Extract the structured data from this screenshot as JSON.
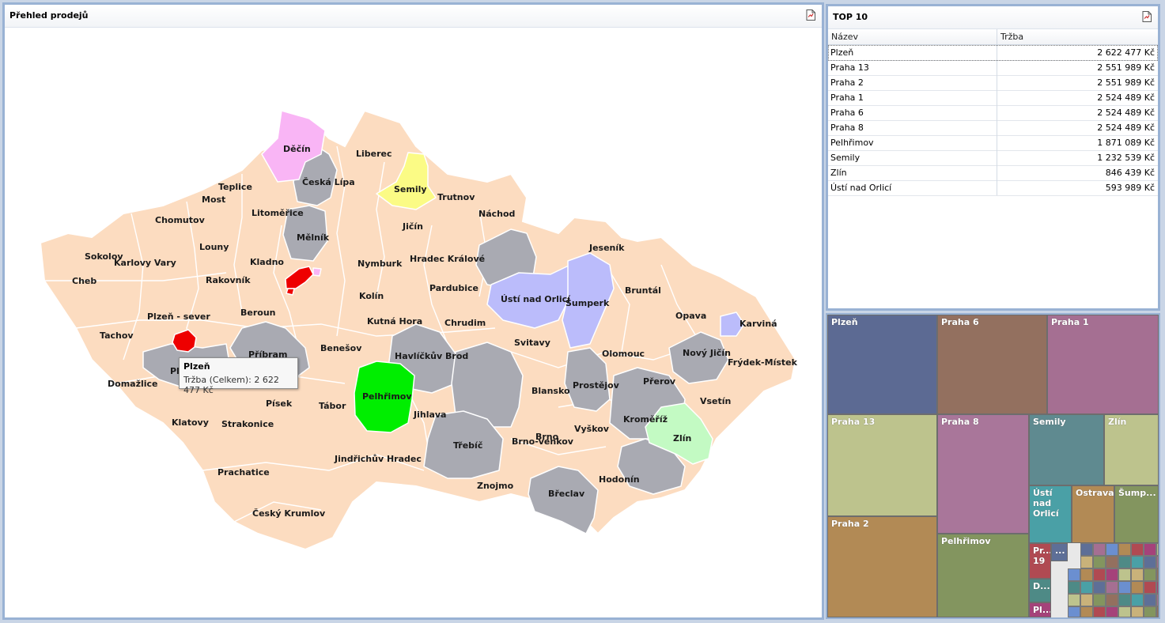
{
  "map_panel": {
    "title": "Přehled prodejů",
    "export_icon": "export-pdf-icon",
    "tooltip": {
      "title": "Plzeň",
      "text": "Tržba (Celkem): 2 622 477 Kč"
    }
  },
  "top10": {
    "title": "TOP 10",
    "export_icon": "export-pdf-icon",
    "columns": [
      "Název",
      "Tržba"
    ],
    "rows": [
      {
        "name": "Plzeň",
        "value": "2 622 477 Kč"
      },
      {
        "name": "Praha 13",
        "value": "2 551 989 Kč"
      },
      {
        "name": "Praha 2",
        "value": "2 551 989 Kč"
      },
      {
        "name": "Praha 1",
        "value": "2 524 489 Kč"
      },
      {
        "name": "Praha 6",
        "value": "2 524 489 Kč"
      },
      {
        "name": "Praha 8",
        "value": "2 524 489 Kč"
      },
      {
        "name": "Pelhřimov",
        "value": "1 871 089 Kč"
      },
      {
        "name": "Semily",
        "value": "1 232 539 Kč"
      },
      {
        "name": "Zlín",
        "value": "846 439 Kč"
      },
      {
        "name": "Ústí nad Orlicí",
        "value": "593 989 Kč"
      }
    ]
  },
  "treemap": {
    "tiles": [
      {
        "label": "Plzeň",
        "color": "#5c6a93"
      },
      {
        "label": "Praha 6",
        "color": "#93705f"
      },
      {
        "label": "Praha 1",
        "color": "#a56f92"
      },
      {
        "label": "Praha 13",
        "color": "#bdc38d"
      },
      {
        "label": "Praha 8",
        "color": "#a9769a"
      },
      {
        "label": "Semily",
        "color": "#5f8a90"
      },
      {
        "label": "Zlín",
        "color": "#bdc38d"
      },
      {
        "label": "Praha 2",
        "color": "#b28a55"
      },
      {
        "label": "Ústí nad Orlicí",
        "color": "#4aa0a6"
      },
      {
        "label": "Ostrava",
        "color": "#b28a55"
      },
      {
        "label": "Šump...",
        "color": "#83955f"
      },
      {
        "label": "Pelhřimov",
        "color": "#83955f"
      },
      {
        "label": "Pr... 19",
        "color": "#b04a52"
      },
      {
        "label": "D...",
        "color": "#4e8a86"
      },
      {
        "label": "Pl...",
        "color": "#a5427a"
      },
      {
        "label": "...",
        "color": "#5e6f97"
      }
    ]
  },
  "map_legend_colors": {
    "default": "#fcdcc0",
    "gray": "#a9aab2",
    "pink": "#f9b5f5",
    "yellow": "#fbfb85",
    "lavender": "#bbbcfb",
    "mint": "#c3fac3",
    "green": "#00ee00",
    "red": "#ee0000"
  },
  "map_labels": {
    "decin": "Děčín",
    "liberec": "Liberec",
    "ceska_lipa": "Česká Lípa",
    "teplice": "Teplice",
    "most": "Most",
    "semily": "Semily",
    "trutnov": "Trutnov",
    "chomutov": "Chomutov",
    "litomerice": "Litoměřice",
    "nachod": "Náchod",
    "jicin": "Jičín",
    "melnik": "Mělník",
    "louny": "Louny",
    "jesenik": "Jeseník",
    "sokolov": "Sokolov",
    "karlovy_vary": "Karlovy Vary",
    "kladno": "Kladno",
    "nymburk": "Nymburk",
    "hradec_kralove": "Hradec Králové",
    "cheb": "Cheb",
    "rakovnik": "Rakovník",
    "pardubice": "Pardubice",
    "bruntal": "Bruntál",
    "usti_orlici": "Ústí nad Orlicí",
    "sumperk": "Šumperk",
    "kolin": "Kolín",
    "plzen_sever": "Plzeň - sever",
    "beroun": "Beroun",
    "opava": "Opava",
    "karvina": "Karviná",
    "kutna_hora": "Kutná Hora",
    "chrudim": "Chrudim",
    "tachov": "Tachov",
    "benesov": "Benešov",
    "svitavy": "Svitavy",
    "novy_jicin": "Nový Jičín",
    "pribram": "Příbram",
    "havlickuv_brod": "Havlíčkův Brod",
    "olomouc": "Olomouc",
    "frydek": "Frýdek-Místek",
    "pl": "Pl",
    "domazlice": "Domažlice",
    "prerov": "Přerov",
    "pelhrimov": "Pelhřimov",
    "blansko": "Blansko",
    "prostejov": "Prostějov",
    "pisek": "Písek",
    "tabor": "Tábor",
    "vsetin": "Vsetín",
    "jihlava": "Jihlava",
    "kromeriz": "Kroměříž",
    "klatovy": "Klatovy",
    "strakonice": "Strakonice",
    "brno": "Brno",
    "brno_venkov": "Brno-venkov",
    "vyskov": "Vyškov",
    "zlin": "Zlín",
    "trebic": "Třebíč",
    "jindrichuv": "Jindřichův Hradec",
    "prachatice": "Prachatice",
    "hodonin": "Hodonín",
    "znojmo": "Znojmo",
    "breclav": "Břeclav",
    "cesky_krumlov": "Český Krumlov"
  }
}
